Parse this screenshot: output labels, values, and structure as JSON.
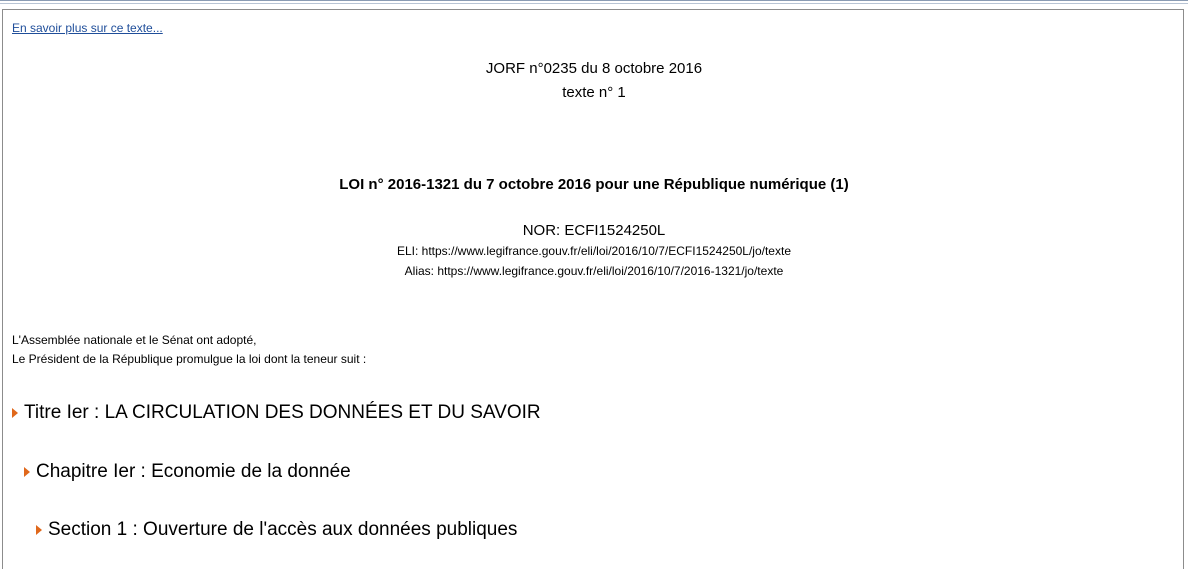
{
  "link": {
    "more": "En savoir plus sur ce texte..."
  },
  "header": {
    "jorf": "JORF n°0235 du 8 octobre 2016",
    "texte": "texte n° 1",
    "title": "LOI n° 2016-1321 du 7 octobre 2016 pour une République numérique (1)",
    "nor": "NOR: ECFI1524250L",
    "eli": "ELI: https://www.legifrance.gouv.fr/eli/loi/2016/10/7/ECFI1524250L/jo/texte",
    "alias": "Alias: https://www.legifrance.gouv.fr/eli/loi/2016/10/7/2016-1321/jo/texte"
  },
  "preamble": {
    "line1": "L'Assemblée nationale et le Sénat ont adopté,",
    "line2": "Le Président de la République promulgue la loi dont la teneur suit :"
  },
  "toc": {
    "titre": "Titre Ier : LA CIRCULATION DES DONNÉES ET DU SAVOIR",
    "chapitre": "Chapitre Ier : Economie de la donnée",
    "section": "Section 1 : Ouverture de l'accès aux données publiques"
  },
  "colors": {
    "link": "#1f4e9a",
    "arrow": "#e0681b",
    "border": "#8c8c8c"
  },
  "icons": {
    "toc_arrow": "triangle-right-icon"
  }
}
